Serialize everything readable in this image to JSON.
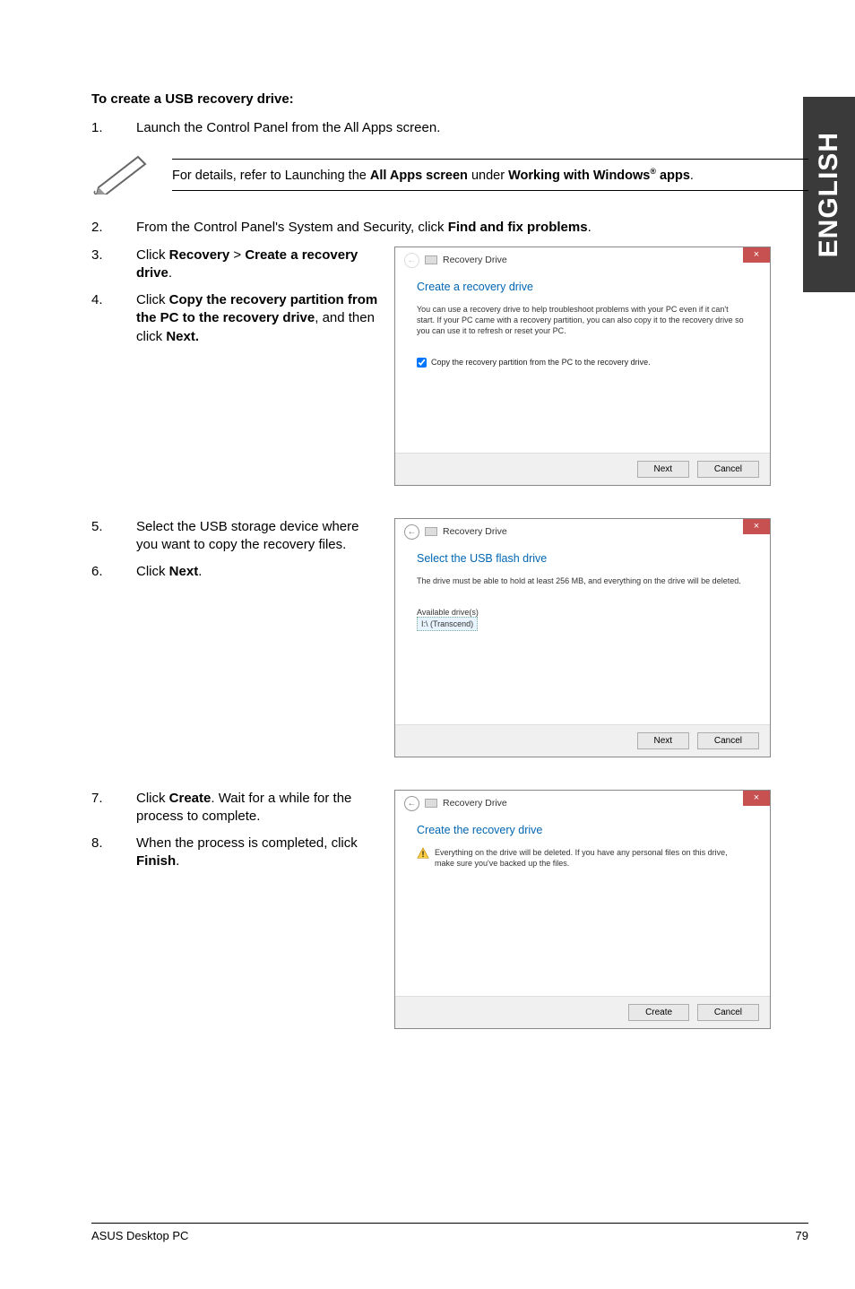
{
  "sideTab": "ENGLISH",
  "sectionTitle": "To create a USB recovery drive:",
  "step1": {
    "num": "1.",
    "text": "Launch the Control Panel from the All Apps screen."
  },
  "note": {
    "pre": "For details, refer to Launching the ",
    "b1": "All Apps screen",
    "mid": " under ",
    "b2": "Working with Windows",
    "sup": "®",
    "b3": " apps",
    "post": "."
  },
  "step2": {
    "num": "2.",
    "pre": "From the Control Panel's System and Security, click ",
    "b": "Find and fix problems",
    "post": "."
  },
  "step3": {
    "num": "3.",
    "pre": "Click ",
    "b1": "Recovery",
    "mid": " > ",
    "b2": "Create a recovery drive",
    "post": "."
  },
  "step4": {
    "num": "4.",
    "pre": "Click ",
    "b1": "Copy the recovery partition from the PC to the recovery drive",
    "mid": ", and then click ",
    "b2": "Next.",
    "post": ""
  },
  "dialog1": {
    "title": "Recovery Drive",
    "heading": "Create a recovery drive",
    "desc": "You can use a recovery drive to help troubleshoot problems with your PC even if it can't start. If your PC came with a recovery partition, you can also copy it to the recovery drive so you can use it to refresh or reset your PC.",
    "checkbox": "Copy the recovery partition from the PC to the recovery drive.",
    "next": "Next",
    "cancel": "Cancel"
  },
  "step5": {
    "num": "5.",
    "text": "Select the USB storage device where you want to copy the recovery files."
  },
  "step6": {
    "num": "6.",
    "pre": "Click ",
    "b": "Next",
    "post": "."
  },
  "dialog2": {
    "title": "Recovery Drive",
    "heading": "Select the USB flash drive",
    "desc": "The drive must be able to hold at least 256 MB, and everything on the drive will be deleted.",
    "availLabel": "Available drive(s)",
    "driveItem": "I:\\ (Transcend)",
    "next": "Next",
    "cancel": "Cancel"
  },
  "step7": {
    "num": "7.",
    "pre": "Click ",
    "b": "Create",
    "post": ". Wait for a while for the process to complete."
  },
  "step8": {
    "num": "8.",
    "pre": "When the process is completed, click ",
    "b": "Finish",
    "post": "."
  },
  "dialog3": {
    "title": "Recovery Drive",
    "heading": "Create the recovery drive",
    "warn": "Everything on the drive will be deleted. If you have any personal files on this drive, make sure you've backed up the files.",
    "create": "Create",
    "cancel": "Cancel"
  },
  "footer": {
    "left": "ASUS Desktop PC",
    "right": "79"
  }
}
